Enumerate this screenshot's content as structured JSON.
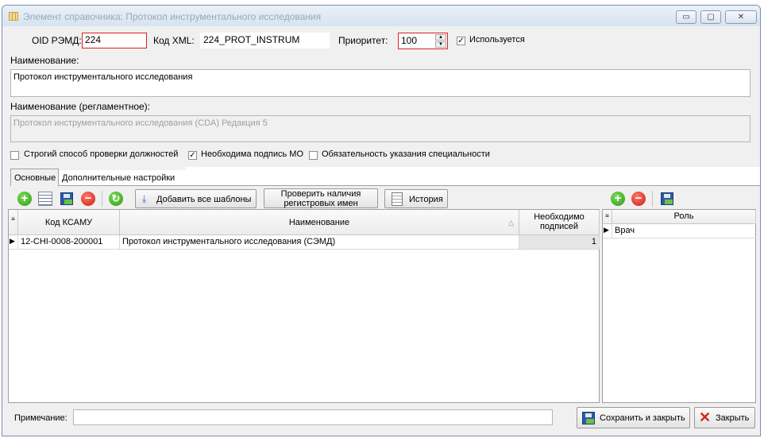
{
  "window": {
    "title": "Элемент справочника: Протокол инструментального исследования"
  },
  "form": {
    "oid_label": "OID РЭМД:",
    "oid_value": "224",
    "xml_label": "Код XML:",
    "xml_value": "224_PROT_INSTRUM",
    "priority_label": "Приоритет:",
    "priority_value": "100",
    "used_label": "Используется",
    "name_label": "Наименование:",
    "name_value": "Протокол инструментального исследования",
    "reg_name_label": "Наименование (регламентное):",
    "reg_name_value": "Протокол инструментального исследования (CDA) Редакция 5",
    "strict_check_label": "Строгий способ проверки должностей",
    "mo_sign_label": "Необходима подпись МО",
    "specialty_label": "Обязательность указания специальности"
  },
  "tabs": [
    {
      "label": "Основные"
    },
    {
      "label": "Дополнительные настройки"
    }
  ],
  "toolbar": {
    "add_all_label": "Добавить все шаблоны",
    "check_line1": "Проверить наличия",
    "check_line2": "регистровых имен",
    "history_label": "История"
  },
  "main_grid": {
    "columns": [
      "Код КСАМУ",
      "Наименование",
      "Необходимо подписей"
    ],
    "rows": [
      {
        "code": "12-CHI-0008-200001",
        "name": "Протокол инструментального исследования (СЭМД)",
        "signs": "1"
      }
    ]
  },
  "role_grid": {
    "column": "Роль",
    "rows": [
      {
        "role": "Врач"
      }
    ]
  },
  "footer": {
    "note_label": "Примечание:",
    "note_value": "",
    "save_close_label": "Сохранить и закрыть",
    "close_label": "Закрыть"
  }
}
